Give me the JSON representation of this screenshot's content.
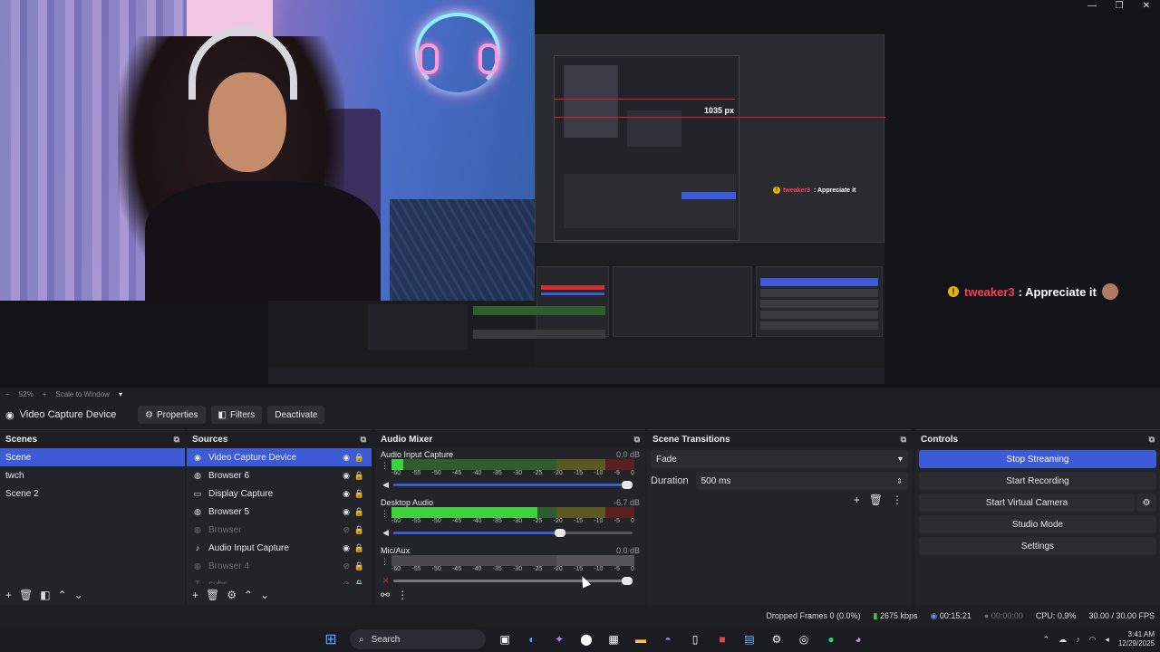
{
  "window": {
    "controls": [
      "—",
      "❐",
      "✕"
    ]
  },
  "preview": {
    "capture_label": "1035 px",
    "chat_small": {
      "user": "tweaker3",
      "message": ": Appreciate it"
    },
    "chat_large": {
      "user": "tweaker3",
      "message": ": Appreciate it"
    }
  },
  "scalebar": {
    "zoom": "52%",
    "mode": "Scale to Window"
  },
  "source_toolbar": {
    "current_source": "Video Capture Device",
    "properties_label": "Properties",
    "filters_label": "Filters",
    "deactivate_label": "Deactivate"
  },
  "scenes": {
    "title": "Scenes",
    "items": [
      {
        "label": "Scene",
        "selected": true
      },
      {
        "label": "twch",
        "selected": false
      },
      {
        "label": "Scene 2",
        "selected": false
      }
    ]
  },
  "sources": {
    "title": "Sources",
    "items": [
      {
        "label": "Video Capture Device",
        "icon": "camera-icon",
        "glyph": "◉",
        "selected": true,
        "visible": true
      },
      {
        "label": "Browser 6",
        "icon": "globe-icon",
        "glyph": "◍",
        "selected": false,
        "visible": true
      },
      {
        "label": "Display Capture",
        "icon": "monitor-icon",
        "glyph": "▭",
        "selected": false,
        "visible": true
      },
      {
        "label": "Browser 5",
        "icon": "globe-icon",
        "glyph": "◍",
        "selected": false,
        "visible": true
      },
      {
        "label": "Browser",
        "icon": "globe-icon",
        "glyph": "◍",
        "selected": false,
        "visible": false
      },
      {
        "label": "Audio Input Capture",
        "icon": "microphone-icon",
        "glyph": "♪",
        "selected": false,
        "visible": true
      },
      {
        "label": "Browser 4",
        "icon": "globe-icon",
        "glyph": "◍",
        "selected": false,
        "visible": false
      },
      {
        "label": "subs",
        "icon": "text-icon",
        "glyph": "T",
        "selected": false,
        "visible": false
      }
    ]
  },
  "mixer": {
    "title": "Audio Mixer",
    "ticks": [
      "-60",
      "-55",
      "-50",
      "-45",
      "-40",
      "-35",
      "-30",
      "-25",
      "-20",
      "-15",
      "-10",
      "-5",
      "0"
    ],
    "channels": [
      {
        "name": "Audio Input Capture",
        "db": "0.0 dB",
        "level": 0.05,
        "volume": 1.0
      },
      {
        "name": "Desktop Audio",
        "db": "-6.7 dB",
        "level": 0.6,
        "volume": 0.72
      },
      {
        "name": "Mic/Aux",
        "db": "0.0 dB",
        "level": 0.0,
        "volume": 1.0,
        "muted": true
      }
    ]
  },
  "transitions": {
    "title": "Scene Transitions",
    "selected": "Fade",
    "duration_label": "Duration",
    "duration_value": "500 ms"
  },
  "controls": {
    "title": "Controls",
    "stop_streaming": "Stop Streaming",
    "start_recording": "Start Recording",
    "start_virtual_camera": "Start Virtual Camera",
    "studio_mode": "Studio Mode",
    "settings": "Settings"
  },
  "status": {
    "dropped_frames": "Dropped Frames 0 (0.0%)",
    "bitrate": "2675 kbps",
    "stream_time": "00:15:21",
    "record_time": "00:00:00",
    "cpu": "CPU: 0.9%",
    "fps": "30.00 / 30.00 FPS"
  },
  "taskbar": {
    "search_label": "Search",
    "time": "3:41 AM",
    "date": "12/29/2025"
  },
  "colors": {
    "accent": "#3d5bd6",
    "panel": "#232428",
    "background": "#1e1f23"
  }
}
